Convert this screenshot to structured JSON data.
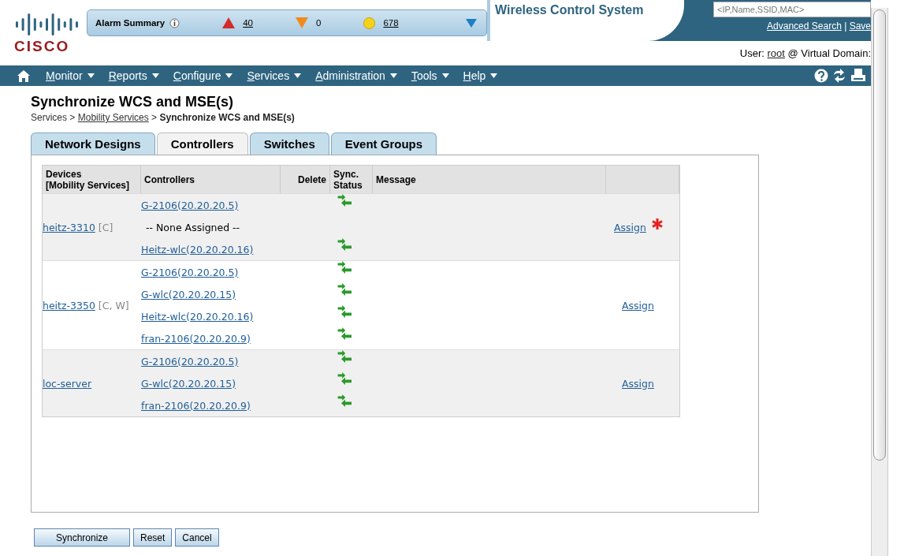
{
  "header": {
    "logo_text": "CISCO",
    "alarm_summary": {
      "label": "Alarm Summary",
      "alarms": [
        {
          "kind": "critical",
          "count": "40",
          "link": true
        },
        {
          "kind": "major",
          "count": "0",
          "link": false
        },
        {
          "kind": "minor",
          "count": "678",
          "link": true
        }
      ]
    },
    "product_title": "Wireless Control System",
    "search": {
      "placeholder": "<IP,Name,SSID,MAC>"
    },
    "links": [
      "Advanced Search",
      "Save"
    ],
    "link_separator": "|",
    "user": {
      "label": "User:",
      "name": "root",
      "domain_label": "@ Virtual Domain:"
    }
  },
  "nav": {
    "items": [
      "Monitor",
      "Reports",
      "Configure",
      "Services",
      "Administration",
      "Tools",
      "Help"
    ]
  },
  "page": {
    "title": "Synchronize WCS and MSE(s)",
    "breadcrumb_separator": ">",
    "breadcrumb": [
      {
        "text": "Services",
        "link": false
      },
      {
        "text": "Mobility Services",
        "link": true
      },
      {
        "text": "Synchronize WCS and MSE(s)",
        "link": false
      }
    ],
    "tabs": [
      {
        "label": "Network Designs",
        "selected": false
      },
      {
        "label": "Controllers",
        "selected": true
      },
      {
        "label": "Switches",
        "selected": false
      },
      {
        "label": "Event Groups",
        "selected": false
      }
    ],
    "table": {
      "columns": [
        "Devices\n[Mobility Services]",
        "Controllers",
        "Delete",
        "Sync.\nStatus",
        "Message"
      ],
      "groups": [
        {
          "device": "heitz-3310",
          "roles": "[C]",
          "action": "Assign",
          "required": true,
          "controllers": [
            {
              "kind": "link",
              "name": "G-2106(20.20.20.5)",
              "sync_icon": true
            },
            {
              "kind": "text",
              "name": "-- None Assigned --",
              "sync_icon": false
            },
            {
              "kind": "link",
              "name": "Heitz-wlc(20.20.20.16)",
              "sync_icon": true
            }
          ]
        },
        {
          "device": "heitz-3350",
          "roles": "[C, W]",
          "action": "Assign",
          "required": false,
          "controllers": [
            {
              "kind": "link",
              "name": "G-2106(20.20.20.5)",
              "sync_icon": true
            },
            {
              "kind": "link",
              "name": "G-wlc(20.20.20.15)",
              "sync_icon": true
            },
            {
              "kind": "link",
              "name": "Heitz-wlc(20.20.20.16)",
              "sync_icon": true
            },
            {
              "kind": "link",
              "name": "fran-2106(20.20.20.9)",
              "sync_icon": true
            }
          ]
        },
        {
          "device": "loc-server",
          "action": "Assign",
          "required": false,
          "controllers": [
            {
              "kind": "link",
              "name": "G-2106(20.20.20.5)",
              "sync_icon": true
            },
            {
              "kind": "link",
              "name": "G-wlc(20.20.20.15)",
              "sync_icon": true
            },
            {
              "kind": "link",
              "name": "fran-2106(20.20.20.9)",
              "sync_icon": true
            }
          ]
        }
      ]
    }
  },
  "buttons": [
    "Synchronize",
    "Reset",
    "Cancel"
  ]
}
